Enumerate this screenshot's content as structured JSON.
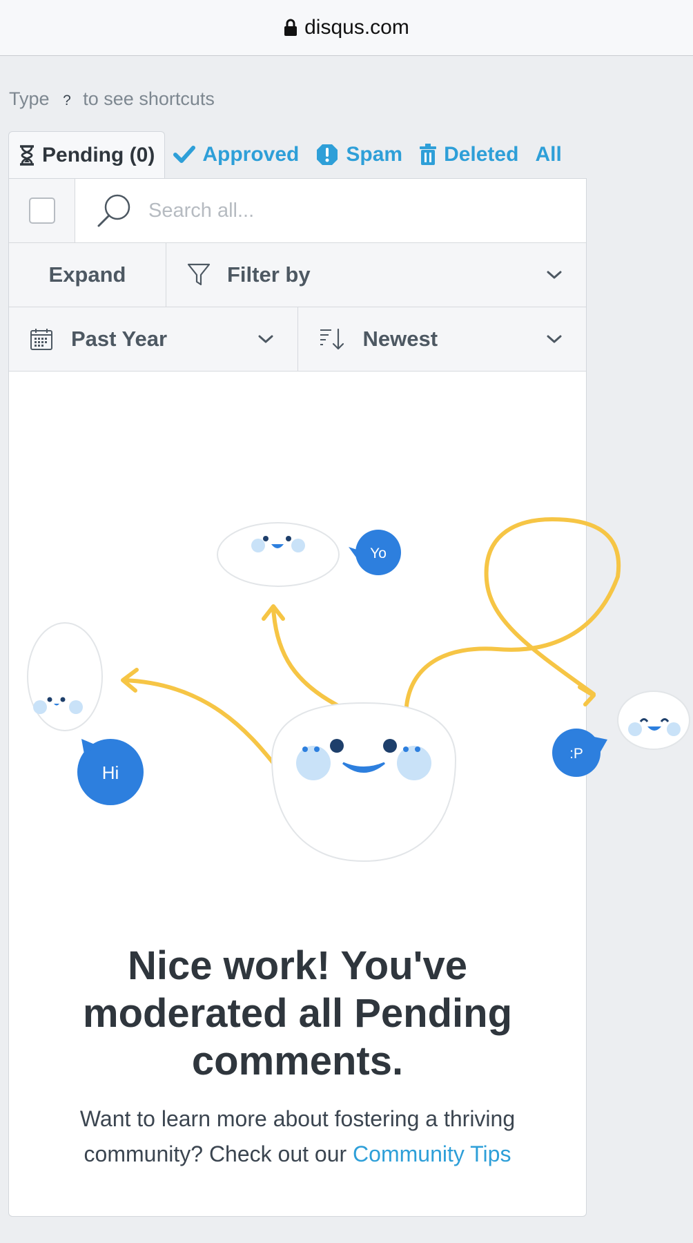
{
  "browser": {
    "url": "disqus.com"
  },
  "shortcut": {
    "prefix": "Type",
    "key": "?",
    "suffix": "to see shortcuts"
  },
  "tabs": [
    {
      "label": "Pending (0)",
      "icon": "hourglass-icon",
      "active": true
    },
    {
      "label": "Approved",
      "icon": "check-icon"
    },
    {
      "label": "Spam",
      "icon": "spam-shield-icon"
    },
    {
      "label": "Deleted",
      "icon": "trash-icon"
    },
    {
      "label": "All"
    }
  ],
  "toolbar": {
    "search_placeholder": "Search all...",
    "expand_label": "Expand",
    "filter_label": "Filter by",
    "date_label": "Past Year",
    "sort_label": "Newest"
  },
  "illustration": {
    "bubble_hi": "Hi",
    "bubble_yo": "Yo",
    "bubble_p": ":P"
  },
  "message": {
    "headline": "Nice work! You've moderated all Pending comments.",
    "body": "Want to learn more about fostering a thriving community? Check out our",
    "link": "Community Tips"
  },
  "colors": {
    "accent": "#2e9fd8",
    "bubble": "#2d7fde",
    "arrow": "#f6c545",
    "text_dark": "#2f363d"
  }
}
